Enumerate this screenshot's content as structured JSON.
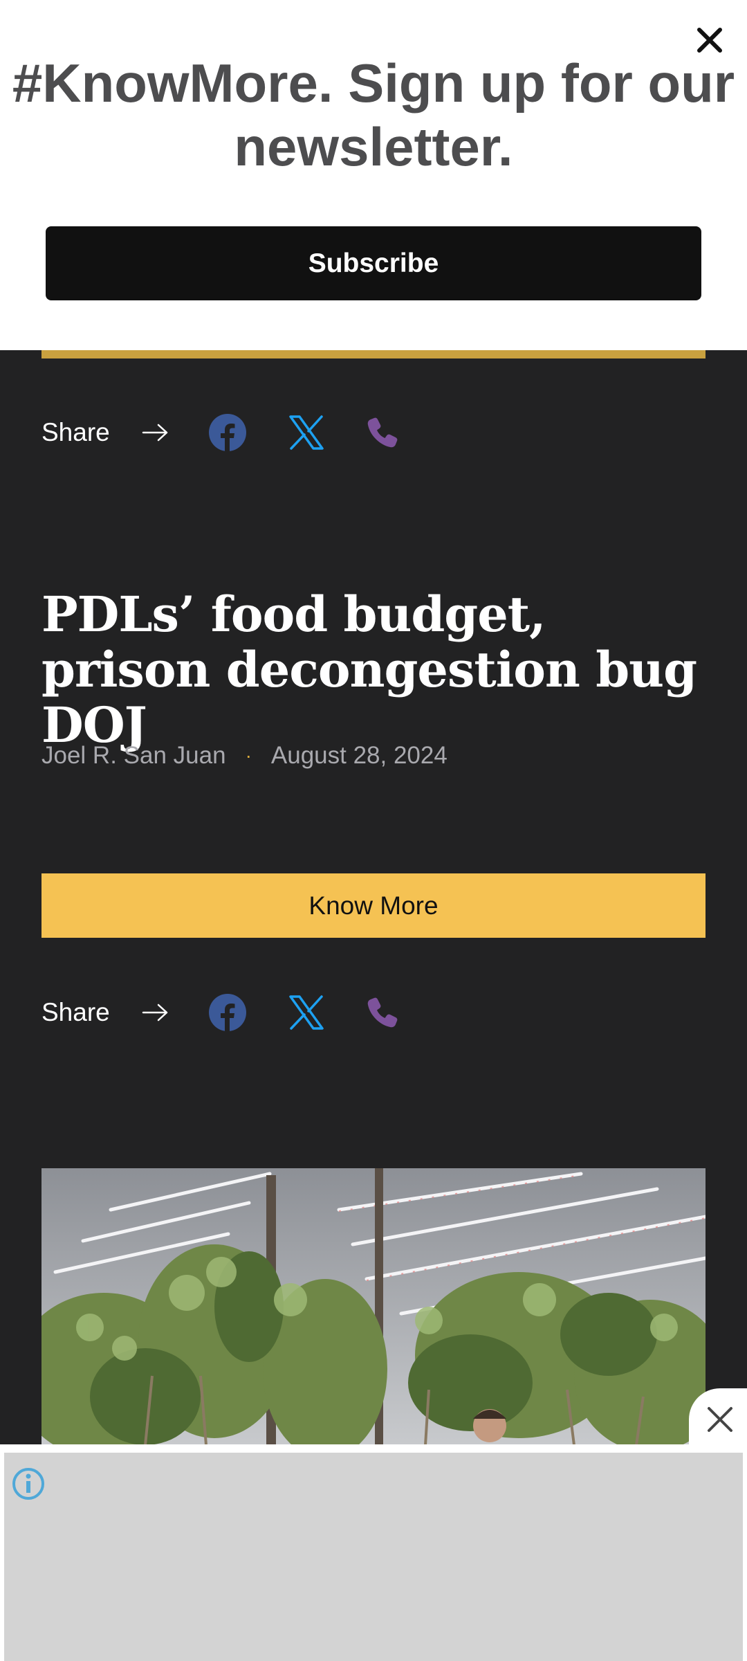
{
  "modal": {
    "title": "#KnowMore. Sign up for our newsletter.",
    "subscribe_label": "Subscribe"
  },
  "share": {
    "label": "Share"
  },
  "article": {
    "headline": "PDLs’ food budget, prison decongestion bug DOJ",
    "author": "Joel R. San Juan",
    "separator": "·",
    "date": "August 28, 2024",
    "cta_label": "Know More"
  },
  "icons": {
    "close": "close-icon",
    "arrow": "arrow-right-icon",
    "facebook": "facebook-icon",
    "x": "x-icon",
    "phone": "phone-icon",
    "info": "info-icon"
  },
  "colors": {
    "background": "#222223",
    "accent_yellow": "#f5c253",
    "facebook": "#3b5998",
    "x": "#1da1f2",
    "phone": "#7d529b"
  }
}
